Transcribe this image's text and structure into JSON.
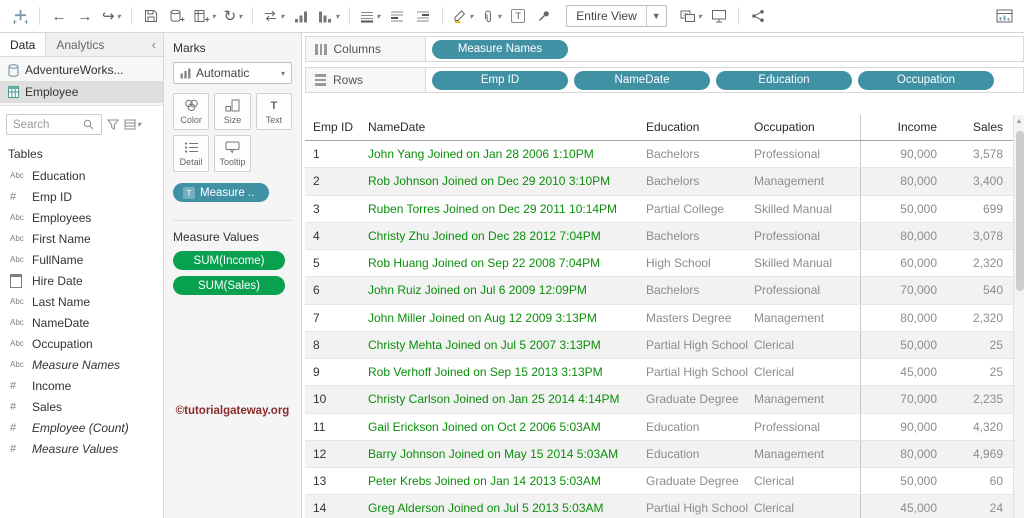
{
  "toolbar": {
    "fit_selector": "Entire View"
  },
  "sidebar": {
    "tabs": [
      "Data",
      "Analytics"
    ],
    "datasources": [
      {
        "label": "AdventureWorks..."
      },
      {
        "label": "Employee"
      }
    ],
    "search_placeholder": "Search",
    "tables_heading": "Tables",
    "fields": [
      {
        "icon": "text-type-icon",
        "glyph": "Abc",
        "label": "Education"
      },
      {
        "icon": "number-type-icon",
        "glyph": "#",
        "label": "Emp ID"
      },
      {
        "icon": "text-type-icon",
        "glyph": "Abc",
        "label": "Employees"
      },
      {
        "icon": "text-type-icon",
        "glyph": "Abc",
        "label": "First Name"
      },
      {
        "icon": "text-type-icon",
        "glyph": "Abc",
        "label": "FullName"
      },
      {
        "icon": "date-type-icon",
        "glyph": "",
        "label": "Hire Date"
      },
      {
        "icon": "text-type-icon",
        "glyph": "Abc",
        "label": "Last Name"
      },
      {
        "icon": "text-type-icon",
        "glyph": "Abc",
        "label": "NameDate"
      },
      {
        "icon": "text-type-icon",
        "glyph": "Abc",
        "label": "Occupation"
      },
      {
        "icon": "text-type-icon",
        "glyph": "Abc",
        "label": "Measure Names",
        "italic": true
      },
      {
        "icon": "number-type-icon",
        "glyph": "#",
        "label": "Income"
      },
      {
        "icon": "number-type-icon",
        "glyph": "#",
        "label": "Sales"
      },
      {
        "icon": "number-type-icon",
        "glyph": "#",
        "label": "Employee (Count)",
        "italic": true
      },
      {
        "icon": "number-type-icon",
        "glyph": "#",
        "label": "Measure Values",
        "italic": true
      }
    ]
  },
  "marks": {
    "title": "Marks",
    "mark_type": "Automatic",
    "buttons": [
      {
        "label": "Color",
        "icon": "color-icon"
      },
      {
        "label": "Size",
        "icon": "size-icon"
      },
      {
        "label": "Text",
        "icon": "text-icon"
      },
      {
        "label": "Detail",
        "icon": "detail-icon"
      },
      {
        "label": "Tooltip",
        "icon": "tooltip-icon"
      }
    ],
    "pill": "Measure .."
  },
  "measure_values": {
    "title": "Measure Values",
    "pills": [
      "SUM(Income)",
      "SUM(Sales)"
    ]
  },
  "watermark": "©tutorialgateway.org",
  "shelves": {
    "columns_label": "Columns",
    "columns_pills": [
      "Measure Names"
    ],
    "rows_label": "Rows",
    "rows_pills": [
      "Emp ID",
      "NameDate",
      "Education",
      "Occupation"
    ]
  },
  "colors": {
    "pill_teal": "#4191a5",
    "pill_green": "#08a14f",
    "namedate_green": "#0a8f0a"
  },
  "table": {
    "headers": [
      "Emp ID",
      "NameDate",
      "Education",
      "Occupation",
      "Income",
      "Sales"
    ],
    "rows": [
      [
        "1",
        "John Yang Joined on Jan 28 2006 1:10PM",
        "Bachelors",
        "Professional",
        "90,000",
        "3,578"
      ],
      [
        "2",
        "Rob Johnson Joined on Dec 29 2010 3:10PM",
        "Bachelors",
        "Management",
        "80,000",
        "3,400"
      ],
      [
        "3",
        "Ruben Torres Joined on Dec 29 2011 10:14PM",
        "Partial College",
        "Skilled Manual",
        "50,000",
        "699"
      ],
      [
        "4",
        "Christy Zhu Joined on Dec 28 2012 7:04PM",
        "Bachelors",
        "Professional",
        "80,000",
        "3,078"
      ],
      [
        "5",
        "Rob Huang Joined on Sep 22 2008 7:04PM",
        "High School",
        "Skilled Manual",
        "60,000",
        "2,320"
      ],
      [
        "6",
        "John Ruiz Joined on Jul 6 2009 12:09PM",
        "Bachelors",
        "Professional",
        "70,000",
        "540"
      ],
      [
        "7",
        "John Miller Joined on Aug 12 2009 3:13PM",
        "Masters Degree",
        "Management",
        "80,000",
        "2,320"
      ],
      [
        "8",
        "Christy Mehta Joined on Jul 5 2007 3:13PM",
        "Partial High School",
        "Clerical",
        "50,000",
        "25"
      ],
      [
        "9",
        "Rob Verhoff Joined on Sep 15 2013 3:13PM",
        "Partial High School",
        "Clerical",
        "45,000",
        "25"
      ],
      [
        "10",
        "Christy Carlson Joined on Jan 25 2014 4:14PM",
        "Graduate Degree",
        "Management",
        "70,000",
        "2,235"
      ],
      [
        "11",
        "Gail Erickson Joined on Oct 2 2006 5:03AM",
        "Education",
        "Professional",
        "90,000",
        "4,320"
      ],
      [
        "12",
        "Barry Johnson Joined on May 15 2014 5:03AM",
        "Education",
        "Management",
        "80,000",
        "4,969"
      ],
      [
        "13",
        "Peter Krebs Joined on Jan 14 2013 5:03AM",
        "Graduate Degree",
        "Clerical",
        "50,000",
        "60"
      ],
      [
        "14",
        "Greg Alderson Joined on Jul 5 2013 5:03AM",
        "Partial High School",
        "Clerical",
        "45,000",
        "24"
      ]
    ]
  }
}
